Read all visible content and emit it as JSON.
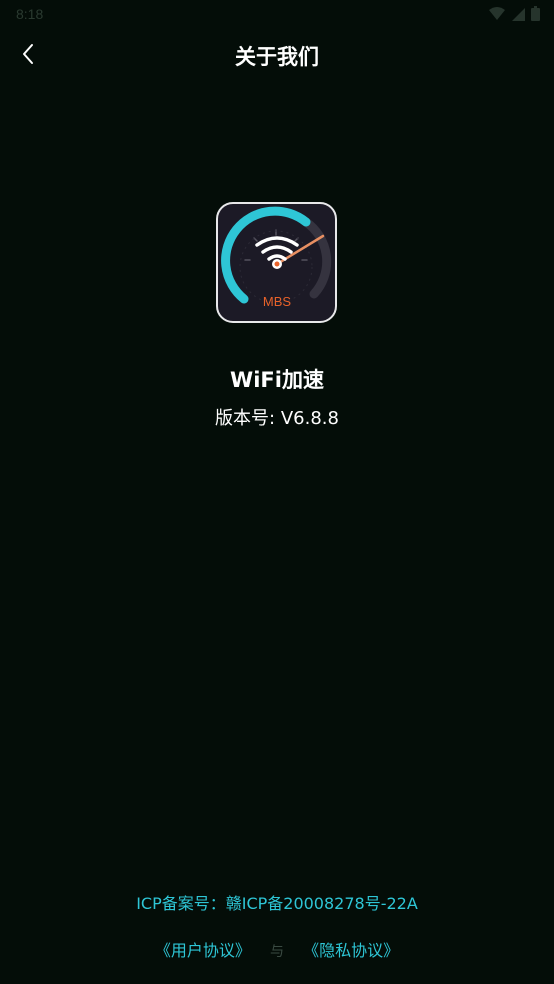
{
  "status_bar": {
    "time": "8:18",
    "icons": [
      "wifi-icon",
      "signal-icon",
      "battery-icon"
    ]
  },
  "header": {
    "title": "关于我们",
    "back_icon": "chevron-left-icon"
  },
  "app": {
    "logo_text": "MBS",
    "name": "WiFi加速",
    "version": "版本号: V6.8.8"
  },
  "footer": {
    "icp": "ICP备案号：赣ICP备20008278号-22A",
    "user_agreement": "《用户协议》",
    "separator": "与",
    "privacy_policy": "《隐私协议》"
  },
  "colors": {
    "background": "#040d08",
    "accent": "#2ec6d6",
    "logo_orange": "#e8622a"
  }
}
